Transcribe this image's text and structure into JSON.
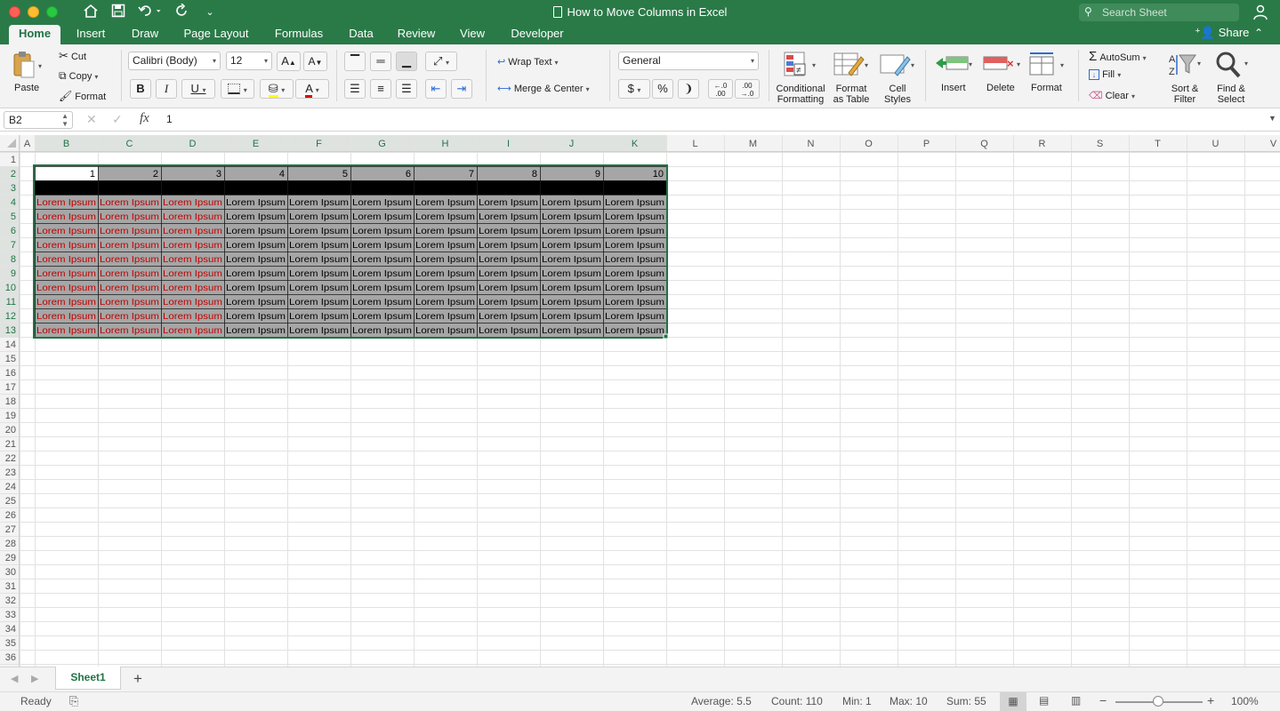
{
  "window": {
    "title": "How to Move Columns in Excel"
  },
  "search": {
    "placeholder": "Search Sheet"
  },
  "tabs": [
    "Home",
    "Insert",
    "Draw",
    "Page Layout",
    "Formulas",
    "Data",
    "Review",
    "View",
    "Developer"
  ],
  "share_label": "Share",
  "clipboard": {
    "paste": "Paste",
    "cut": "Cut",
    "copy": "Copy",
    "format": "Format"
  },
  "font": {
    "name": "Calibri (Body)",
    "size": "12"
  },
  "alignment": {
    "wrap": "Wrap Text",
    "merge": "Merge & Center"
  },
  "number": {
    "format": "General",
    "currency": "$",
    "percent": "%"
  },
  "styles": {
    "conditional": [
      "Conditional",
      "Formatting"
    ],
    "format_table": [
      "Format",
      "as Table"
    ],
    "cell_styles": [
      "Cell",
      "Styles"
    ]
  },
  "cells": {
    "insert": "Insert",
    "delete": "Delete",
    "format": "Format"
  },
  "editing": {
    "autosum": "AutoSum",
    "fill": "Fill",
    "clear": "Clear",
    "sort": [
      "Sort &",
      "Filter"
    ],
    "find": [
      "Find &",
      "Select"
    ]
  },
  "formula_bar": {
    "name_box": "B2",
    "fx": "fx",
    "value": "1"
  },
  "columns": [
    "A",
    "B",
    "C",
    "D",
    "E",
    "F",
    "G",
    "H",
    "I",
    "J",
    "K",
    "L",
    "M",
    "N",
    "O",
    "P",
    "Q",
    "R",
    "S",
    "T",
    "U",
    "V"
  ],
  "row_count": 36,
  "sheet": {
    "header_values": [
      "1",
      "2",
      "3",
      "4",
      "5",
      "6",
      "7",
      "8",
      "9",
      "10"
    ],
    "cell_text": "Lorem Ipsum",
    "data_rows": 10,
    "red_columns": 3
  },
  "sheet_tab": "Sheet1",
  "status": {
    "ready": "Ready",
    "average": "Average: 5.5",
    "count": "Count: 110",
    "min": "Min: 1",
    "max": "Max: 10",
    "sum": "Sum: 55",
    "zoom": "100%"
  },
  "colors": {
    "brand": "#2a7a48",
    "accent": "#217346",
    "red_text": "#c00000",
    "cell_gray": "#a6a6a6",
    "black_bar": "#000000"
  }
}
